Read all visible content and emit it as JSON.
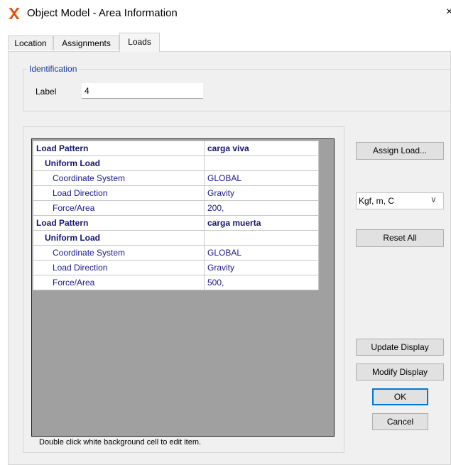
{
  "window": {
    "title": "Object Model - Area Information",
    "close_glyph": "×"
  },
  "tabs": [
    {
      "label": "Location",
      "active": false
    },
    {
      "label": "Assignments",
      "active": false
    },
    {
      "label": "Loads",
      "active": true
    }
  ],
  "identification": {
    "legend": "Identification",
    "label_caption": "Label",
    "label_value": "4"
  },
  "grid": {
    "rows": [
      {
        "key": "Load Pattern",
        "value": "carga viva",
        "level": 0
      },
      {
        "key": "Uniform Load",
        "value": "",
        "level": 1
      },
      {
        "key": "Coordinate System",
        "value": "GLOBAL",
        "level": 2
      },
      {
        "key": "Load Direction",
        "value": "Gravity",
        "level": 2
      },
      {
        "key": "Force/Area",
        "value": "200,",
        "level": 2
      },
      {
        "key": "Load Pattern",
        "value": "carga muerta",
        "level": 0
      },
      {
        "key": "Uniform Load",
        "value": "",
        "level": 1
      },
      {
        "key": "Coordinate System",
        "value": "GLOBAL",
        "level": 2
      },
      {
        "key": "Load Direction",
        "value": "Gravity",
        "level": 2
      },
      {
        "key": "Force/Area",
        "value": "500,",
        "level": 2
      }
    ],
    "hint": "Double click white background cell to edit item."
  },
  "buttons": {
    "assign_load": "Assign Load...",
    "reset_all": "Reset All",
    "update_display": "Update Display",
    "modify_display": "Modify Display",
    "ok": "OK",
    "cancel": "Cancel"
  },
  "units": {
    "selected": "Kgf, m, C",
    "arrow": "∨"
  },
  "colors": {
    "accent": "#0078d7",
    "grid_text": "#1a1a8c",
    "legend_text": "#1a3a9a",
    "icon_orange": "#f08a1c",
    "icon_red": "#d4281c"
  }
}
